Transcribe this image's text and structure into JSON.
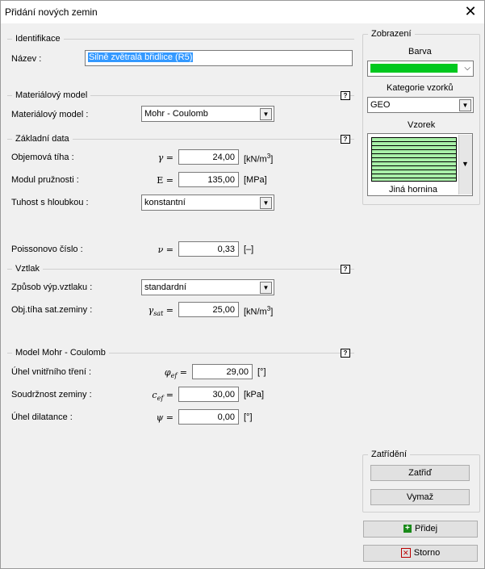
{
  "title": "Přidání nových zemin",
  "identifikace": {
    "header": "Identifikace",
    "name_label": "Název :",
    "name_value": "Silně zvětralá břidlice (R5)"
  },
  "material_model": {
    "header": "Materiálový model",
    "label": "Materiálový model :",
    "value": "Mohr - Coulomb"
  },
  "basic": {
    "header": "Základní data",
    "unit_weight": {
      "label": "Objemová tíha :",
      "symbol": "γ =",
      "value": "24,00",
      "unit": "[kN/m",
      "sup": "3",
      "unit_close": "]"
    },
    "modulus": {
      "label": "Modul pružnosti :",
      "symbol": "E =",
      "value": "135,00",
      "unit": "[MPa]"
    },
    "stiffness": {
      "label": "Tuhost s hloubkou :",
      "value": "konstantní"
    },
    "poisson": {
      "label": "Poissonovo číslo :",
      "symbol": "ν =",
      "value": "0,33",
      "unit": "[–]"
    }
  },
  "buoyancy": {
    "header": "Vztlak",
    "method_label": "Způsob výp.vztlaku :",
    "method_value": "standardní",
    "sat_label": "Obj.tíha sat.zeminy :",
    "sat_symbol": "γ",
    "sat_sub": "sat",
    "sat_eq": " =",
    "sat_value": "25,00",
    "sat_unit": "[kN/m",
    "sat_sup": "3",
    "sat_unit_close": "]"
  },
  "mohr": {
    "header": "Model Mohr - Coulomb",
    "friction": {
      "label": "Úhel vnitřního tření :",
      "symbol": "φ",
      "sub": "ef",
      "eq": " =",
      "value": "29,00",
      "unit": "[°]"
    },
    "cohesion": {
      "label": "Soudržnost zeminy :",
      "symbol": "c",
      "sub": "ef",
      "eq": " =",
      "value": "30,00",
      "unit": "[kPa]"
    },
    "dilatancy": {
      "label": "Úhel dilatance :",
      "symbol": "ψ =",
      "value": "0,00",
      "unit": "[°]"
    }
  },
  "help_glyph": "?",
  "display": {
    "header": "Zobrazení",
    "color_label": "Barva",
    "color_value": "#00c81e",
    "category_label": "Kategorie vzorků",
    "category_value": "GEO",
    "pattern_label": "Vzorek",
    "pattern_name": "Jiná hornina",
    "pattern_color": "#a8f0a8"
  },
  "classification": {
    "header": "Zatřídění",
    "classify": "Zatřiď",
    "remove": "Vymaž"
  },
  "add_label": "Přidej",
  "cancel_label": "Storno",
  "close_glyph": "✕",
  "arrow_glyph": "▼"
}
